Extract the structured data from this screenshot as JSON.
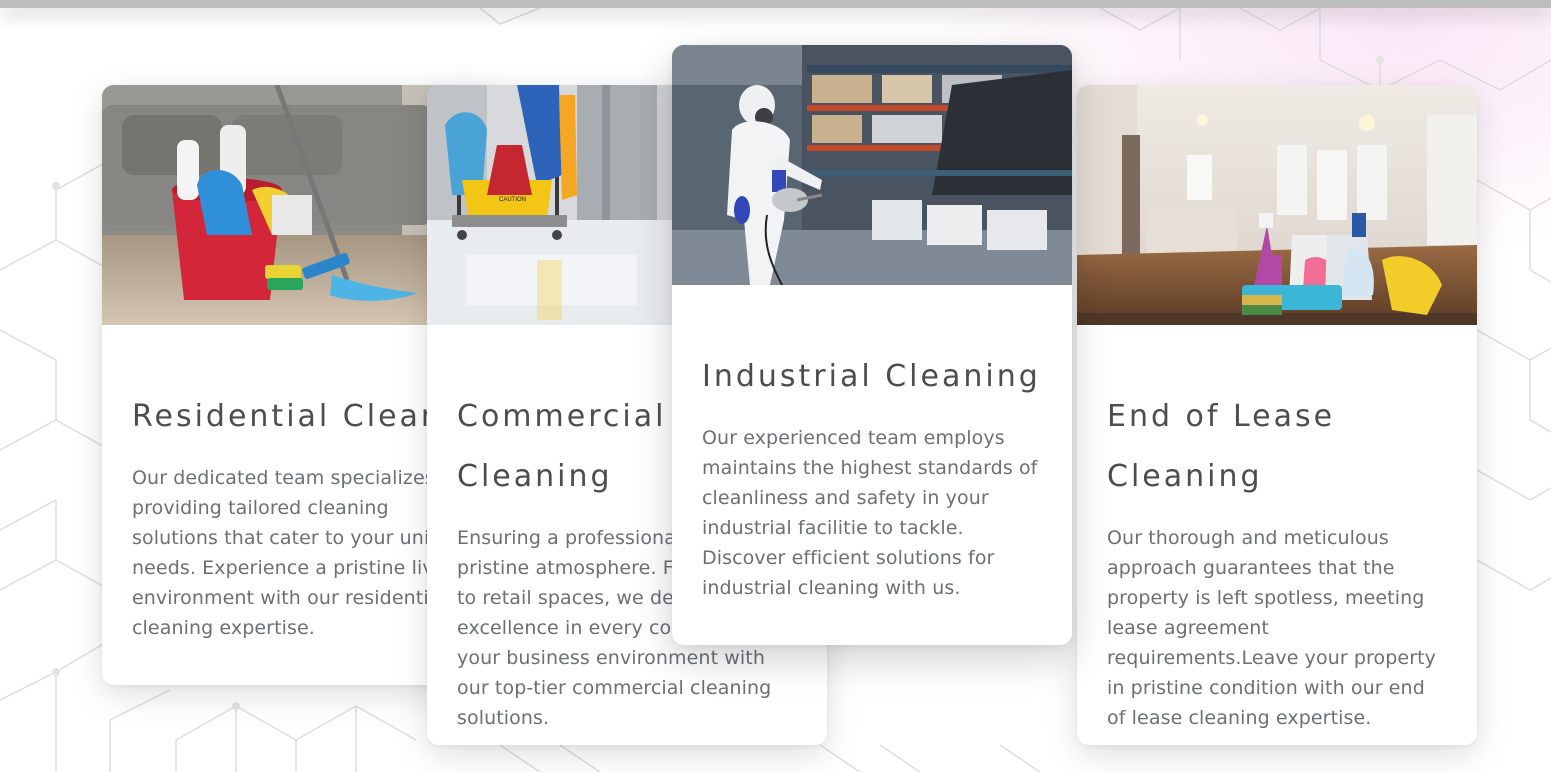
{
  "cards": [
    {
      "title": "Residential Cleaning",
      "description": "Our dedicated team specializes in providing tailored cleaning solutions that cater to your unique needs. Experience a pristine living environment with our residential cleaning expertise.",
      "image": "cleaning-supplies-living-room-photo"
    },
    {
      "title": "Commercial Cleaning",
      "description": "Ensuring a professional and pristine atmosphere. From offices to retail spaces, we deliver excellence in every corner. Elevate your business environment with our top-tier commercial cleaning solutions.",
      "image": "janitor-cart-office-photo"
    },
    {
      "title": "Industrial Cleaning",
      "description": "Our experienced team employs maintains the highest standards of cleanliness and safety in your industrial facilitie to tackle. Discover efficient solutions for industrial cleaning with us.",
      "image": "warehouse-protective-suit-worker-photo"
    },
    {
      "title": "End of Lease Cleaning",
      "description": "Our thorough and meticulous approach guarantees that the property is left spotless, meeting lease agreement requirements.Leave your property in pristine condition with our end of lease cleaning expertise.",
      "image": "empty-apartment-cleaning-products-photo"
    }
  ],
  "theme": {
    "title_color": "#4d4d4d",
    "text_color": "#6b6f76",
    "card_background": "#ffffff",
    "pattern_color": "#d9d9d9"
  }
}
